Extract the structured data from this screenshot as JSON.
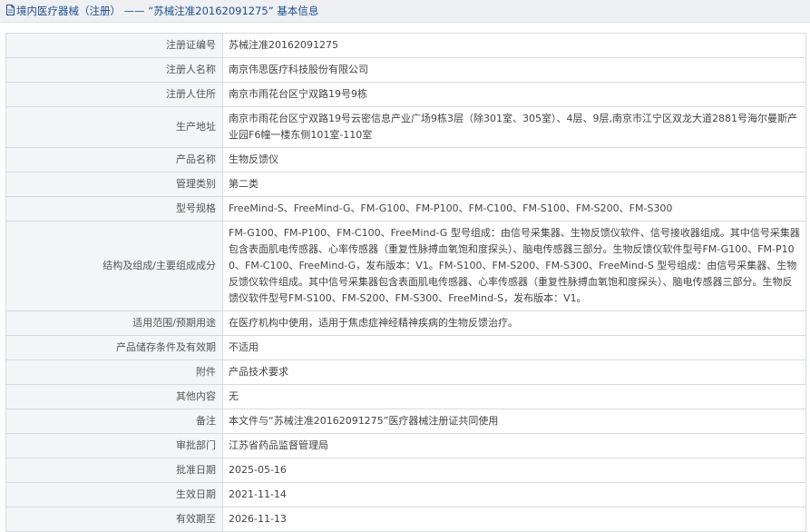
{
  "header": {
    "title": "境内医疗器械（注册） —— “苏械注准20162091275” 基本信息"
  },
  "rows": [
    {
      "label": "注册证编号",
      "value": "苏械注准20162091275"
    },
    {
      "label": "注册人名称",
      "value": "南京伟思医疗科技股份有限公司"
    },
    {
      "label": "注册人住所",
      "value": "南京市雨花台区宁双路19号9栋"
    },
    {
      "label": "生产地址",
      "value": "南京市雨花台区宁双路19号云密信息产业广场9栋3层（除301室、305室）、4层、9层,南京市江宁区双龙大道2881号海尔曼斯产业园F6幢一楼东侧101室-110室"
    },
    {
      "label": "产品名称",
      "value": "生物反馈仪"
    },
    {
      "label": "管理类别",
      "value": "第二类"
    },
    {
      "label": "型号规格",
      "value": "FreeMind-S、FreeMind-G、FM-G100、FM-P100、FM-C100、FM-S100、FM-S200、FM-S300"
    },
    {
      "label": "结构及组成/主要组成成分",
      "value": "FM-G100、FM-P100、FM-C100、FreeMind-G 型号组成：由信号采集器、生物反馈仪软件、信号接收器组成。其中信号采集器包含表面肌电传感器、心率传感器（重复性脉搏血氧饱和度探头）、脑电传感器三部分。生物反馈仪软件型号FM-G100、FM-P100、FM-C100、FreeMind-G，发布版本：V1。FM-S100、FM-S200、FM-S300、FreeMind-S 型号组成：由信号采集器、生物反馈仪软件组成。其中信号采集器包含表面肌电传感器、心率传感器（重复性脉搏血氧饱和度探头）、脑电传感器三部分。生物反馈仪软件型号FM-S100、FM-S200、FM-S300、FreeMind-S，发布版本：V1。"
    },
    {
      "label": "适用范围/预期用途",
      "value": "在医疗机构中使用，适用于焦虑症神经精神疾病的生物反馈治疗。"
    },
    {
      "label": "产品储存条件及有效期",
      "value": "不适用"
    },
    {
      "label": "附件",
      "value": "产品技术要求"
    },
    {
      "label": "其他内容",
      "value": "无"
    },
    {
      "label": "备注",
      "value": "本文件与“苏械注准20162091275”医疗器械注册证共同使用"
    },
    {
      "label": "审批部门",
      "value": "江苏省药品监督管理局"
    },
    {
      "label": "批准日期",
      "value": "2025-05-16"
    },
    {
      "label": "生效日期",
      "value": "2021-11-14"
    },
    {
      "label": "有效期至",
      "value": "2026-11-13"
    }
  ]
}
